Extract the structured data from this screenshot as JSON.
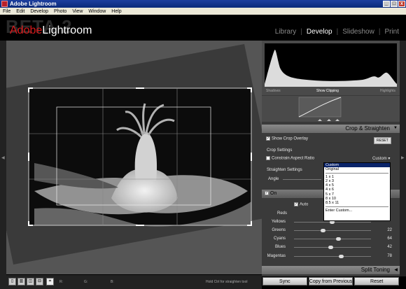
{
  "window": {
    "title": "Adobe Lightroom",
    "min": "_",
    "max": "□",
    "close": "x"
  },
  "menu": [
    "File",
    "Edit",
    "Develop",
    "Photo",
    "View",
    "Window",
    "Help"
  ],
  "header": {
    "beta": "BETA 2",
    "logo_adobe": "Adobe",
    "logo_product": "Lightroom"
  },
  "modules": [
    "Library",
    "Develop",
    "Slideshow",
    "Print"
  ],
  "modules_sep": "|",
  "histogram": {
    "left": "Shadows",
    "center": "Show Clipping",
    "right": "Highlights"
  },
  "crop": {
    "header": "Crop & Straighten",
    "show_overlay": "Show Crop Overlay",
    "reset": "RESET",
    "settings_label": "Crop Settings",
    "constrain": "Constrain Aspect Ratio",
    "aspect_value": "Custom",
    "straighten": "Straighten Settings",
    "angle": "Angle"
  },
  "dropdown": [
    "Custom",
    "Original",
    "",
    "1 x 1",
    "2 x 3",
    "4 x 5",
    "4 x 6",
    "5 x 7",
    "8 x 10",
    "8.5 x 11",
    "",
    "Enter Custom..."
  ],
  "hsl": {
    "on": "On",
    "auto": "Auto",
    "sliders": [
      {
        "label": "Reds",
        "value": ""
      },
      {
        "label": "Yellows",
        "value": "",
        "pos": 0.47
      },
      {
        "label": "Greens",
        "value": "22",
        "pos": 0.35
      },
      {
        "label": "Cyans",
        "value": "64",
        "pos": 0.55
      },
      {
        "label": "Blues",
        "value": "42",
        "pos": 0.45
      },
      {
        "label": "Magentas",
        "value": "78",
        "pos": 0.58
      }
    ]
  },
  "split": {
    "header": "Split Toning"
  },
  "buttons": {
    "sync": "Sync",
    "copy": "Copy from Previous",
    "reset": "Reset"
  },
  "toolbar": {
    "r": "R:",
    "g": "G:",
    "b": "B:",
    "hint": "Hold Ctrl for straighten tool"
  }
}
